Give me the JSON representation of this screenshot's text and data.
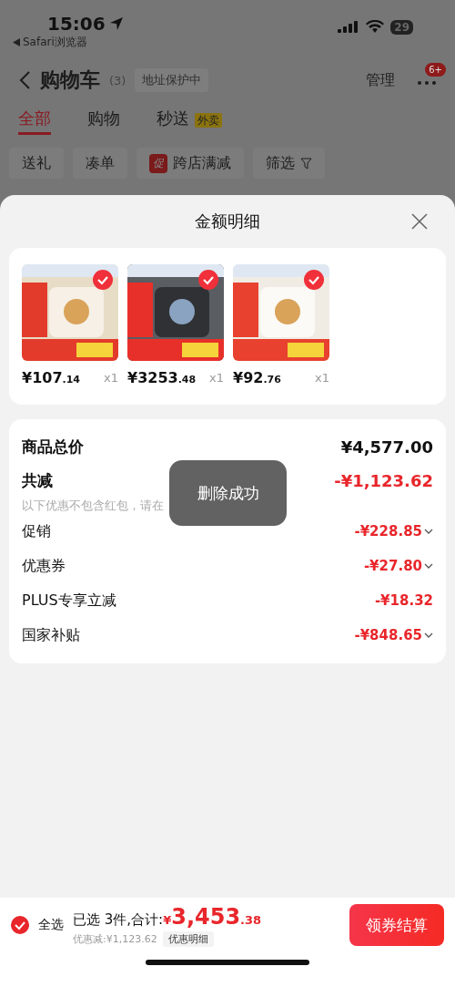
{
  "status_bar": {
    "time": "15:06",
    "back_app": "Safari浏览器",
    "battery": "29"
  },
  "nav": {
    "title": "购物车",
    "count": "(3)",
    "address": "地址保护中",
    "manage": "管理",
    "badge": "6+"
  },
  "tabs": [
    {
      "label": "全部",
      "selected": true
    },
    {
      "label": "购物",
      "selected": false
    },
    {
      "label": "秒送",
      "tag": "外卖",
      "selected": false
    }
  ],
  "chips": [
    {
      "label": "送礼"
    },
    {
      "label": "凑单"
    },
    {
      "label": "跨店满减",
      "tag": "促"
    },
    {
      "label": "筛选",
      "kind": "filter"
    }
  ],
  "sheet": {
    "title": "金额明细",
    "products": [
      {
        "kind": "picture",
        "price": "¥107",
        "cents": ".14",
        "qty": "x1",
        "selected": true
      },
      {
        "kind": "picture",
        "price": "¥3253",
        "cents": ".48",
        "qty": "x1",
        "selected": true
      },
      {
        "kind": "picture",
        "price": "¥92",
        "cents": ".76",
        "qty": "x1",
        "selected": true
      }
    ],
    "total": {
      "label": "商品总价",
      "value": "¥4,577.00"
    },
    "discount": {
      "label": "共减",
      "value": "-¥1,123.62",
      "note": "以下优惠不包含红包，请在"
    },
    "rows": [
      {
        "label": "促销",
        "value": "-¥228.85",
        "expandable": true
      },
      {
        "label": "优惠券",
        "value": "-¥27.80",
        "expandable": true
      },
      {
        "label": "PLUS专享立减",
        "value": "-¥18.32",
        "expandable": false
      },
      {
        "label": "国家补贴",
        "value": "-¥848.65",
        "expandable": true
      }
    ]
  },
  "toast": "删除成功",
  "footer": {
    "select_all": {
      "label": "全选",
      "checked": true
    },
    "summary": "已选 3件,合计:",
    "currency": "¥",
    "amount": "3,453",
    "cents": ".38",
    "saved": "优惠减:¥1,123.62",
    "detail": "优惠明细",
    "checkout": "领券结算"
  }
}
